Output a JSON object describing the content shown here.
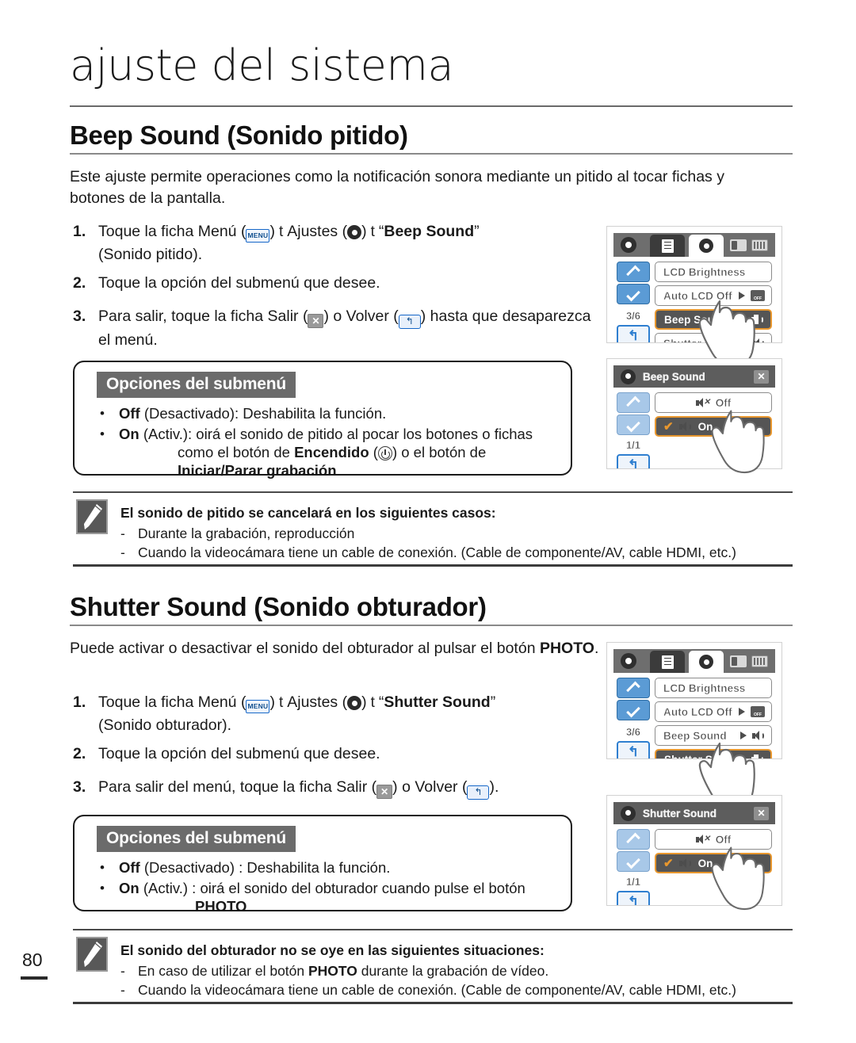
{
  "chapter": {
    "title": "ajuste del sistema"
  },
  "page": {
    "number": "80"
  },
  "sections": [
    {
      "heading": "Beep Sound (Sonido pitido)",
      "intro": "Este ajuste permite operaciones como la notificación sonora mediante un pitido al tocar fichas y botones de la pantalla.",
      "steps": [
        {
          "num": "1.",
          "pre": "Toque la ficha Menú (",
          "icon1": "MENU",
          "mid1": ")",
          "arrow1": "t",
          "mid2": "Ajustes (",
          "icon2": "gear-icon",
          "mid3": ")",
          "arrow2": "t",
          "quote_open": "“",
          "bold": "Beep Sound",
          "quote_close": "”",
          "tail": "(Sonido pitido)."
        },
        {
          "num": "2.",
          "text": "Toque la opción del submenú que desee."
        },
        {
          "num": "3.",
          "pre": "Para salir, toque la ficha Salir (",
          "mid": ") o Volver (",
          "tail": ") hasta que desaparezca el menú."
        }
      ],
      "options_box": {
        "badge": "Opciones del submenú",
        "items": [
          {
            "bullet": "•",
            "bold": "Off",
            "text": " (Desactivado): Deshabilita la función."
          },
          {
            "bullet": "•",
            "bold": "On",
            "text": " (Activ.): oirá el sonido de pitido al pocar los botones o fichas"
          }
        ],
        "cont_line1_pre": "como el botón de ",
        "cont_line1_bold": "Encendido",
        "cont_line1_mid": " (",
        "cont_line1_post": ") o el botón de",
        "cont_line2_bold": "Iniciar/Parar grabación",
        "cont_line2_post": "."
      },
      "note": {
        "heading": "El sonido de pitido se cancelará en los siguientes casos:",
        "items": [
          {
            "dash": "-",
            "text": "Durante la grabación, reproducción"
          },
          {
            "dash": "-",
            "text": "Cuando la videocámara tiene un cable de conexión. (Cable de componente/AV, cable HDMI, etc.)"
          }
        ]
      }
    },
    {
      "heading": "Shutter Sound (Sonido obturador)",
      "intro_pre": "Puede activar o desactivar el sonido del obturador al pulsar el botón ",
      "intro_bold": "PHOTO",
      "intro_post": ".",
      "steps": [
        {
          "num": "1.",
          "pre": "Toque la ficha Menú (",
          "icon1": "MENU",
          "mid1": ")",
          "arrow1": "t",
          "mid2": "Ajustes (",
          "icon2": "gear-icon",
          "mid3": ")",
          "arrow2": "t",
          "quote_open": "“",
          "bold": "Shutter Sound",
          "quote_close": "”",
          "tail": "(Sonido obturador)."
        },
        {
          "num": "2.",
          "text": "Toque la opción del submenú que desee."
        },
        {
          "num": "3.",
          "pre": "Para salir del menú, toque la ficha Salir (",
          "mid": ") o Volver (",
          "tail": ")."
        }
      ],
      "options_box": {
        "badge": "Opciones del submenú",
        "items": [
          {
            "bullet": "•",
            "bold": "Off",
            "text": " (Desactivado) : Deshabilita la función."
          },
          {
            "bullet": "•",
            "bold": "On",
            "text": " (Activ.) : oirá el sonido del obturador cuando pulse el botón"
          }
        ],
        "cont_line1_bold": "PHOTO",
        "cont_line1_post": "."
      },
      "note": {
        "heading": "El sonido del obturador no se oye en las siguientes situaciones:",
        "items": [
          {
            "dash": "-",
            "pre": "En caso de utilizar el botón ",
            "bold": "PHOTO",
            "post": " durante la grabación de vídeo."
          },
          {
            "dash": "-",
            "text": "Cuando la videocámara tiene un cable de conexión. (Cable de componente/AV, cable HDMI, etc.)"
          }
        ]
      }
    }
  ],
  "lcd_screens": [
    {
      "id": "beep-menu",
      "type": "main-menu",
      "page_indicator": "3/6",
      "rows": [
        {
          "label": "LCD Brightness",
          "selected": false,
          "arrow": false,
          "right_icon": "none"
        },
        {
          "label": "Auto LCD Off",
          "selected": false,
          "arrow": true,
          "right_icon": "lcd-off-icon"
        },
        {
          "label": "Beep Sound",
          "selected": true,
          "arrow": true,
          "right_icon": "speaker-icon"
        },
        {
          "label": "Shutter Sound",
          "selected": false,
          "arrow": false,
          "right_icon": "speaker-icon"
        }
      ]
    },
    {
      "id": "beep-submenu",
      "type": "submenu",
      "title": "Beep Sound",
      "page_indicator": "1/1",
      "rows": [
        {
          "label": "Off",
          "selected": false,
          "checked": false,
          "icon": "speaker-mute-icon"
        },
        {
          "label": "On",
          "selected": true,
          "checked": true,
          "icon": "speaker-icon"
        }
      ]
    },
    {
      "id": "shutter-menu",
      "type": "main-menu",
      "page_indicator": "3/6",
      "rows": [
        {
          "label": "LCD Brightness",
          "selected": false,
          "arrow": false,
          "right_icon": "none"
        },
        {
          "label": "Auto LCD Off",
          "selected": false,
          "arrow": true,
          "right_icon": "lcd-off-icon"
        },
        {
          "label": "Beep Sound",
          "selected": false,
          "arrow": true,
          "right_icon": "speaker-icon"
        },
        {
          "label": "Shutter Sound",
          "selected": true,
          "arrow": true,
          "right_icon": "speaker-icon"
        }
      ]
    },
    {
      "id": "shutter-submenu",
      "type": "submenu",
      "title": "Shutter Sound",
      "page_indicator": "1/1",
      "rows": [
        {
          "label": "Off",
          "selected": false,
          "checked": false,
          "icon": "speaker-mute-icon"
        },
        {
          "label": "On",
          "selected": true,
          "checked": true,
          "icon": "speaker-icon"
        }
      ]
    }
  ],
  "colors": {
    "accent_orange": "#e8972e",
    "accent_blue": "#2f7fd0",
    "badge_gray": "#6b6b6b",
    "lcd_bar": "#6e6e6e",
    "selected_row": "#555555"
  }
}
